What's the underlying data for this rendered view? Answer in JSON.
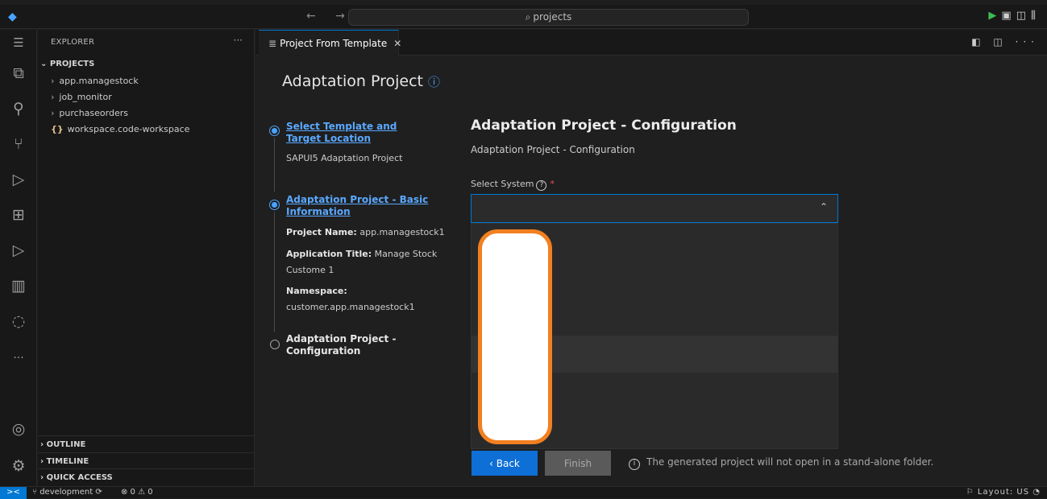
{
  "titlebar": {
    "nav": "← →",
    "search_icon": "⌕",
    "search_text": "projects",
    "actions": [
      "▶",
      "▣",
      "◫",
      "⫼"
    ]
  },
  "sidebar": {
    "title": "EXPLORER",
    "more": "···",
    "section": "PROJECTS",
    "items": [
      {
        "label": "app.managestock",
        "kind": "folder"
      },
      {
        "label": "job_monitor",
        "kind": "folder"
      },
      {
        "label": "purchaseorders",
        "kind": "folder"
      },
      {
        "label": "workspace.code-workspace",
        "kind": "file"
      }
    ],
    "bottom_sections": [
      "OUTLINE",
      "TIMELINE",
      "QUICK ACCESS"
    ]
  },
  "tab": {
    "label": "Project From Template",
    "close": "✕"
  },
  "editor_actions": "◧ ◫ ···",
  "page": {
    "title": "Adaptation Project",
    "steps": [
      {
        "title": "Select Template and Target Location",
        "details": [
          {
            "key": "",
            "value": "SAPUI5 Adaptation Project"
          }
        ]
      },
      {
        "title": "Adaptation Project - Basic Information",
        "details": [
          {
            "key": "Project Name:",
            "value": "app.managestock1"
          },
          {
            "key": "Application Title:",
            "value": "Manage Stock Custome 1"
          },
          {
            "key": "Namespace:",
            "value": "customer.app.managestock1"
          }
        ]
      },
      {
        "title": "Adaptation Project - Configuration"
      }
    ],
    "config": {
      "title": "Adaptation Project - Configuration",
      "subtitle": "Adaptation Project - Configuration",
      "select_label": "Select System",
      "required_mark": "*",
      "select_value": ""
    },
    "buttons": {
      "back": "‹ Back",
      "finish": "Finish"
    },
    "note": "The generated project will not open in a stand-alone folder."
  },
  "statusbar": {
    "remote": "><",
    "branch": "development",
    "problems": "⊗ 0 ⚠ 0",
    "right": "Layout: US"
  },
  "colors": {
    "accent": "#0078d4",
    "link": "#5aa8ff",
    "redaction_border": "#f28020"
  }
}
